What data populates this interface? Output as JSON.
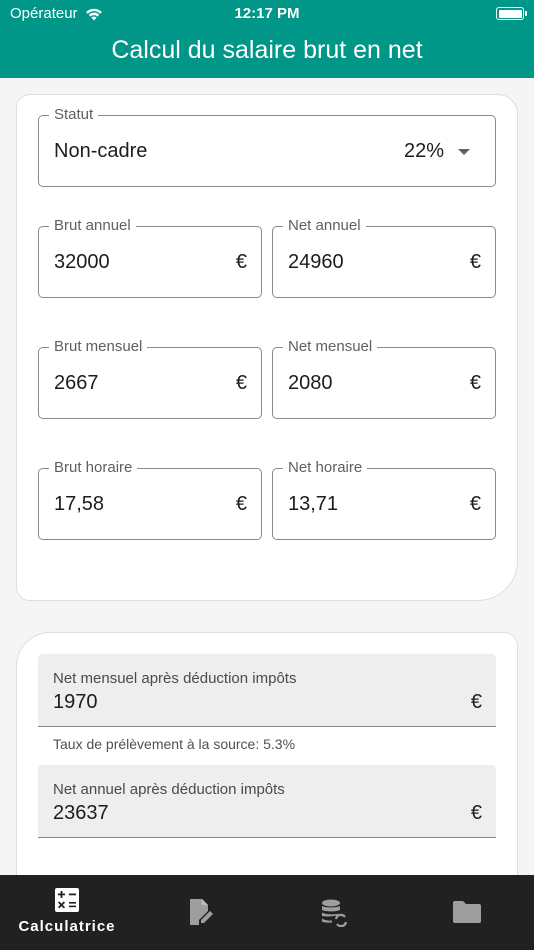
{
  "status_bar": {
    "carrier": "Opérateur",
    "time": "12:17 PM"
  },
  "app": {
    "title": "Calcul du salaire brut en net",
    "header_color": "#009688"
  },
  "form": {
    "statut": {
      "label": "Statut",
      "value": "Non-cadre",
      "rate": "22%"
    },
    "brut_annuel": {
      "label": "Brut annuel",
      "value": "32000",
      "currency": "€"
    },
    "net_annuel": {
      "label": "Net annuel",
      "value": "24960",
      "currency": "€"
    },
    "brut_mensuel": {
      "label": "Brut mensuel",
      "value": "2667",
      "currency": "€"
    },
    "net_mensuel": {
      "label": "Net mensuel",
      "value": "2080",
      "currency": "€"
    },
    "brut_horaire": {
      "label": "Brut horaire",
      "value": "17,58",
      "currency": "€"
    },
    "net_horaire": {
      "label": "Net horaire",
      "value": "13,71",
      "currency": "€"
    }
  },
  "results": {
    "net_mensuel_impots": {
      "label": "Net mensuel après déduction impôts",
      "value": "1970",
      "currency": "€"
    },
    "taux": "Taux de prélèvement à la source: 5.3%",
    "net_annuel_impots": {
      "label": "Net annuel après déduction impôts",
      "value": "23637",
      "currency": "€"
    }
  },
  "tabs": [
    {
      "label": "Calculatrice",
      "icon": "calculator-icon",
      "active": true
    },
    {
      "label": "",
      "icon": "edit-document-icon",
      "active": false
    },
    {
      "label": "",
      "icon": "database-sync-icon",
      "active": false
    },
    {
      "label": "",
      "icon": "folder-icon",
      "active": false
    }
  ]
}
